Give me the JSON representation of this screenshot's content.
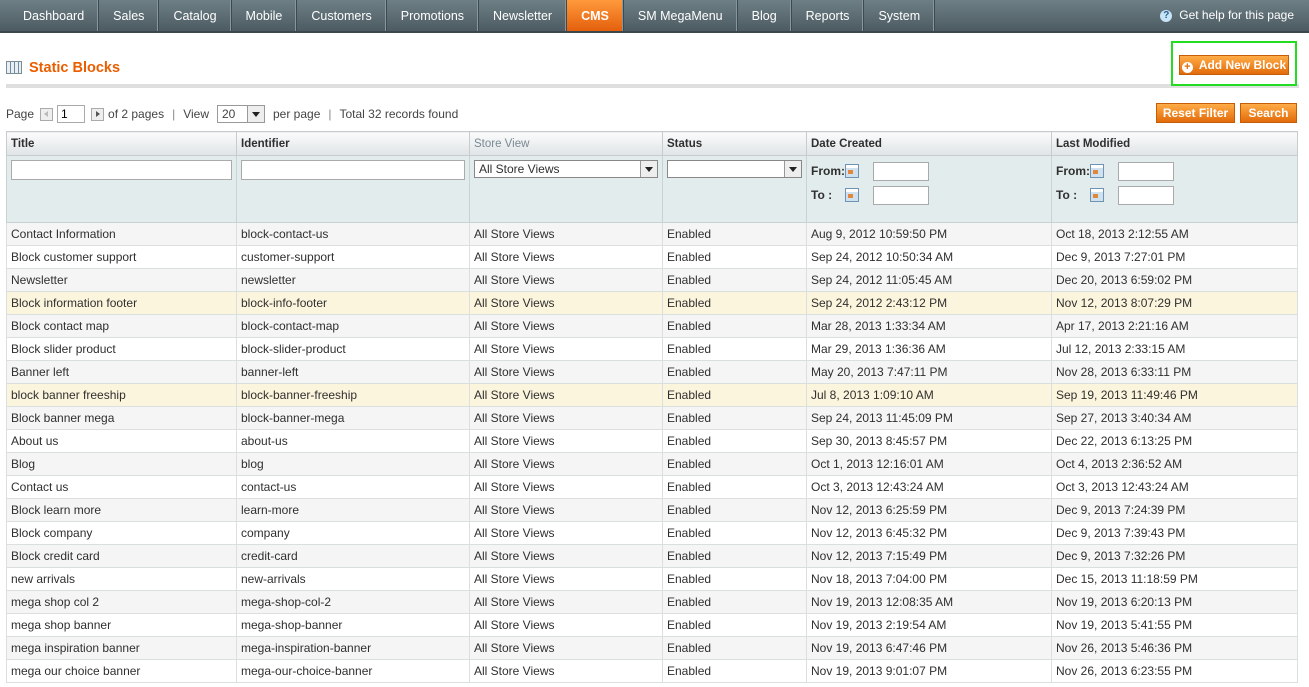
{
  "nav": {
    "items": [
      "Dashboard",
      "Sales",
      "Catalog",
      "Mobile",
      "Customers",
      "Promotions",
      "Newsletter",
      "CMS",
      "SM MegaMenu",
      "Blog",
      "Reports",
      "System"
    ],
    "active_index": 7,
    "help_text": "Get help for this page"
  },
  "header": {
    "title": "Static Blocks",
    "add_button": "Add New Block"
  },
  "pager": {
    "page_label": "Page",
    "page_value": "1",
    "of_pages": "of 2 pages",
    "view_label": "View",
    "view_value": "20",
    "per_page": "per page",
    "total": "Total 32 records found"
  },
  "actions": {
    "reset_filter": "Reset Filter",
    "search": "Search"
  },
  "columns": [
    "Title",
    "Identifier",
    "Store View",
    "Status",
    "Date Created",
    "Last Modified"
  ],
  "filters": {
    "store_view": "All Store Views",
    "status": "",
    "from_label": "From:",
    "to_label": "To :"
  },
  "rows": [
    {
      "title": "Contact Information",
      "identifier": "block-contact-us",
      "store": "All Store Views",
      "status": "Enabled",
      "created": "Aug 9, 2012 10:59:50 PM",
      "modified": "Oct 18, 2013 2:12:55 AM"
    },
    {
      "title": "Block customer support",
      "identifier": "customer-support",
      "store": "All Store Views",
      "status": "Enabled",
      "created": "Sep 24, 2012 10:50:34 AM",
      "modified": "Dec 9, 2013 7:27:01 PM"
    },
    {
      "title": "Newsletter",
      "identifier": "newsletter",
      "store": "All Store Views",
      "status": "Enabled",
      "created": "Sep 24, 2012 11:05:45 AM",
      "modified": "Dec 20, 2013 6:59:02 PM"
    },
    {
      "title": "Block information footer",
      "identifier": "block-info-footer",
      "store": "All Store Views",
      "status": "Enabled",
      "created": "Sep 24, 2012 2:43:12 PM",
      "modified": "Nov 12, 2013 8:07:29 PM"
    },
    {
      "title": "Block contact map",
      "identifier": "block-contact-map",
      "store": "All Store Views",
      "status": "Enabled",
      "created": "Mar 28, 2013 1:33:34 AM",
      "modified": "Apr 17, 2013 2:21:16 AM"
    },
    {
      "title": "Block slider product",
      "identifier": "block-slider-product",
      "store": "All Store Views",
      "status": "Enabled",
      "created": "Mar 29, 2013 1:36:36 AM",
      "modified": "Jul 12, 2013 2:33:15 AM"
    },
    {
      "title": "Banner left",
      "identifier": "banner-left",
      "store": "All Store Views",
      "status": "Enabled",
      "created": "May 20, 2013 7:47:11 PM",
      "modified": "Nov 28, 2013 6:33:11 PM"
    },
    {
      "title": "block banner freeship",
      "identifier": "block-banner-freeship",
      "store": "All Store Views",
      "status": "Enabled",
      "created": "Jul 8, 2013 1:09:10 AM",
      "modified": "Sep 19, 2013 11:49:46 PM"
    },
    {
      "title": "Block banner mega",
      "identifier": "block-banner-mega",
      "store": "All Store Views",
      "status": "Enabled",
      "created": "Sep 24, 2013 11:45:09 PM",
      "modified": "Sep 27, 2013 3:40:34 AM"
    },
    {
      "title": "About us",
      "identifier": "about-us",
      "store": "All Store Views",
      "status": "Enabled",
      "created": "Sep 30, 2013 8:45:57 PM",
      "modified": "Dec 22, 2013 6:13:25 PM"
    },
    {
      "title": "Blog",
      "identifier": "blog",
      "store": "All Store Views",
      "status": "Enabled",
      "created": "Oct 1, 2013 12:16:01 AM",
      "modified": "Oct 4, 2013 2:36:52 AM"
    },
    {
      "title": "Contact us",
      "identifier": "contact-us",
      "store": "All Store Views",
      "status": "Enabled",
      "created": "Oct 3, 2013 12:43:24 AM",
      "modified": "Oct 3, 2013 12:43:24 AM"
    },
    {
      "title": "Block learn more",
      "identifier": "learn-more",
      "store": "All Store Views",
      "status": "Enabled",
      "created": "Nov 12, 2013 6:25:59 PM",
      "modified": "Dec 9, 2013 7:24:39 PM"
    },
    {
      "title": "Block company",
      "identifier": "company",
      "store": "All Store Views",
      "status": "Enabled",
      "created": "Nov 12, 2013 6:45:32 PM",
      "modified": "Dec 9, 2013 7:39:43 PM"
    },
    {
      "title": "Block credit card",
      "identifier": "credit-card",
      "store": "All Store Views",
      "status": "Enabled",
      "created": "Nov 12, 2013 7:15:49 PM",
      "modified": "Dec 9, 2013 7:32:26 PM"
    },
    {
      "title": "new arrivals",
      "identifier": "new-arrivals",
      "store": "All Store Views",
      "status": "Enabled",
      "created": "Nov 18, 2013 7:04:00 PM",
      "modified": "Dec 15, 2013 11:18:59 PM"
    },
    {
      "title": "mega shop col 2",
      "identifier": "mega-shop-col-2",
      "store": "All Store Views",
      "status": "Enabled",
      "created": "Nov 19, 2013 12:08:35 AM",
      "modified": "Nov 19, 2013 6:20:13 PM"
    },
    {
      "title": "mega shop banner",
      "identifier": "mega-shop-banner",
      "store": "All Store Views",
      "status": "Enabled",
      "created": "Nov 19, 2013 2:19:54 AM",
      "modified": "Nov 19, 2013 5:41:55 PM"
    },
    {
      "title": "mega inspiration banner",
      "identifier": "mega-inspiration-banner",
      "store": "All Store Views",
      "status": "Enabled",
      "created": "Nov 19, 2013 6:47:46 PM",
      "modified": "Nov 26, 2013 5:46:36 PM"
    },
    {
      "title": "mega our choice banner",
      "identifier": "mega-our-choice-banner",
      "store": "All Store Views",
      "status": "Enabled",
      "created": "Nov 19, 2013 9:01:07 PM",
      "modified": "Nov 26, 2013 6:23:55 PM"
    }
  ]
}
